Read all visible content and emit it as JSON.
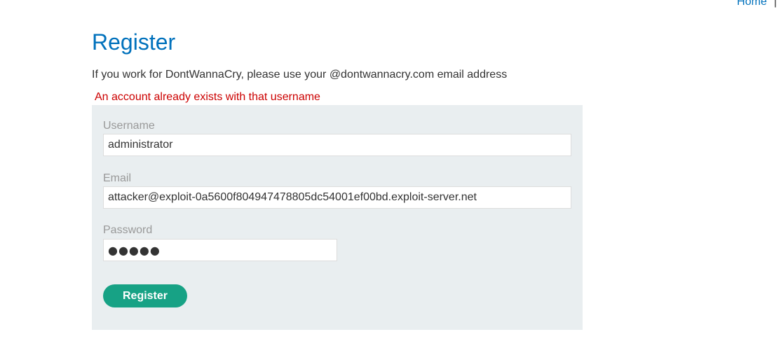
{
  "nav": {
    "home_label": "Home",
    "separator": "|"
  },
  "page": {
    "title": "Register",
    "intro": "If you work for DontWannaCry, please use your @dontwannacry.com email address",
    "error": "An account already exists with that username"
  },
  "form": {
    "username_label": "Username",
    "username_value": "administrator",
    "email_label": "Email",
    "email_value": "attacker@exploit-0a5600f804947478805dc54001ef00bd.exploit-server.net",
    "password_label": "Password",
    "password_value": "●●●●●",
    "submit_label": "Register"
  },
  "colors": {
    "link": "#0071bc",
    "error": "#cc0000",
    "button": "#17a285",
    "form_background": "#e9eef0"
  }
}
